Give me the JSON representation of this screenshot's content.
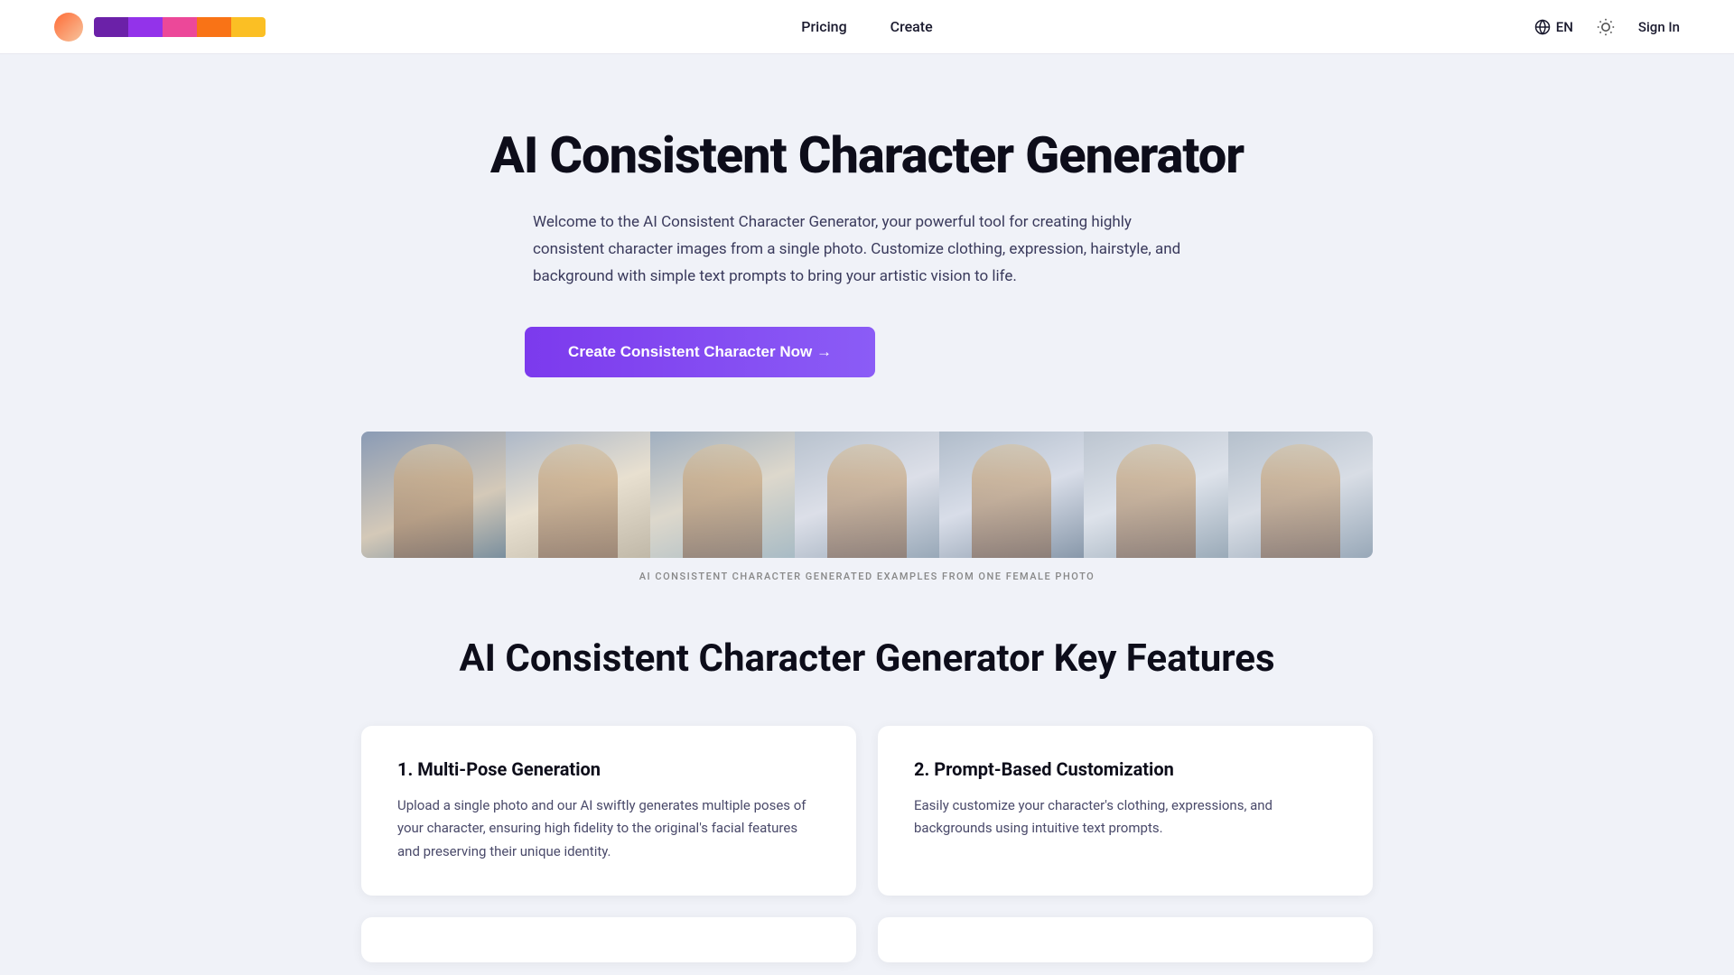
{
  "nav": {
    "pricing_label": "Pricing",
    "create_label": "Create",
    "lang_label": "EN",
    "signin_label": "Sign In"
  },
  "logo": {
    "segments": [
      "#6b21a8",
      "#9333ea",
      "#ec4899",
      "#f97316",
      "#fbbf24"
    ]
  },
  "hero": {
    "title": "AI Consistent Character Generator",
    "description": "Welcome to the AI Consistent Character Generator, your powerful tool for creating highly consistent character images from a single photo. Customize clothing, expression, hairstyle, and background with simple text prompts to bring your artistic vision to life.",
    "cta_label": "Create Consistent Character Now →"
  },
  "gallery": {
    "caption": "AI CONSISTENT CHARACTER GENERATED EXAMPLES FROM ONE FEMALE PHOTO",
    "images": [
      1,
      2,
      3,
      4,
      5,
      6,
      7
    ]
  },
  "features": {
    "section_title": "AI Consistent Character Generator Key Features",
    "cards": [
      {
        "title": "1. Multi-Pose Generation",
        "description": "Upload a single photo and our AI swiftly generates multiple poses of your character, ensuring high fidelity to the original's facial features and preserving their unique identity."
      },
      {
        "title": "2. Prompt-Based Customization",
        "description": "Easily customize your character's clothing, expressions, and backgrounds using intuitive text prompts."
      }
    ]
  }
}
